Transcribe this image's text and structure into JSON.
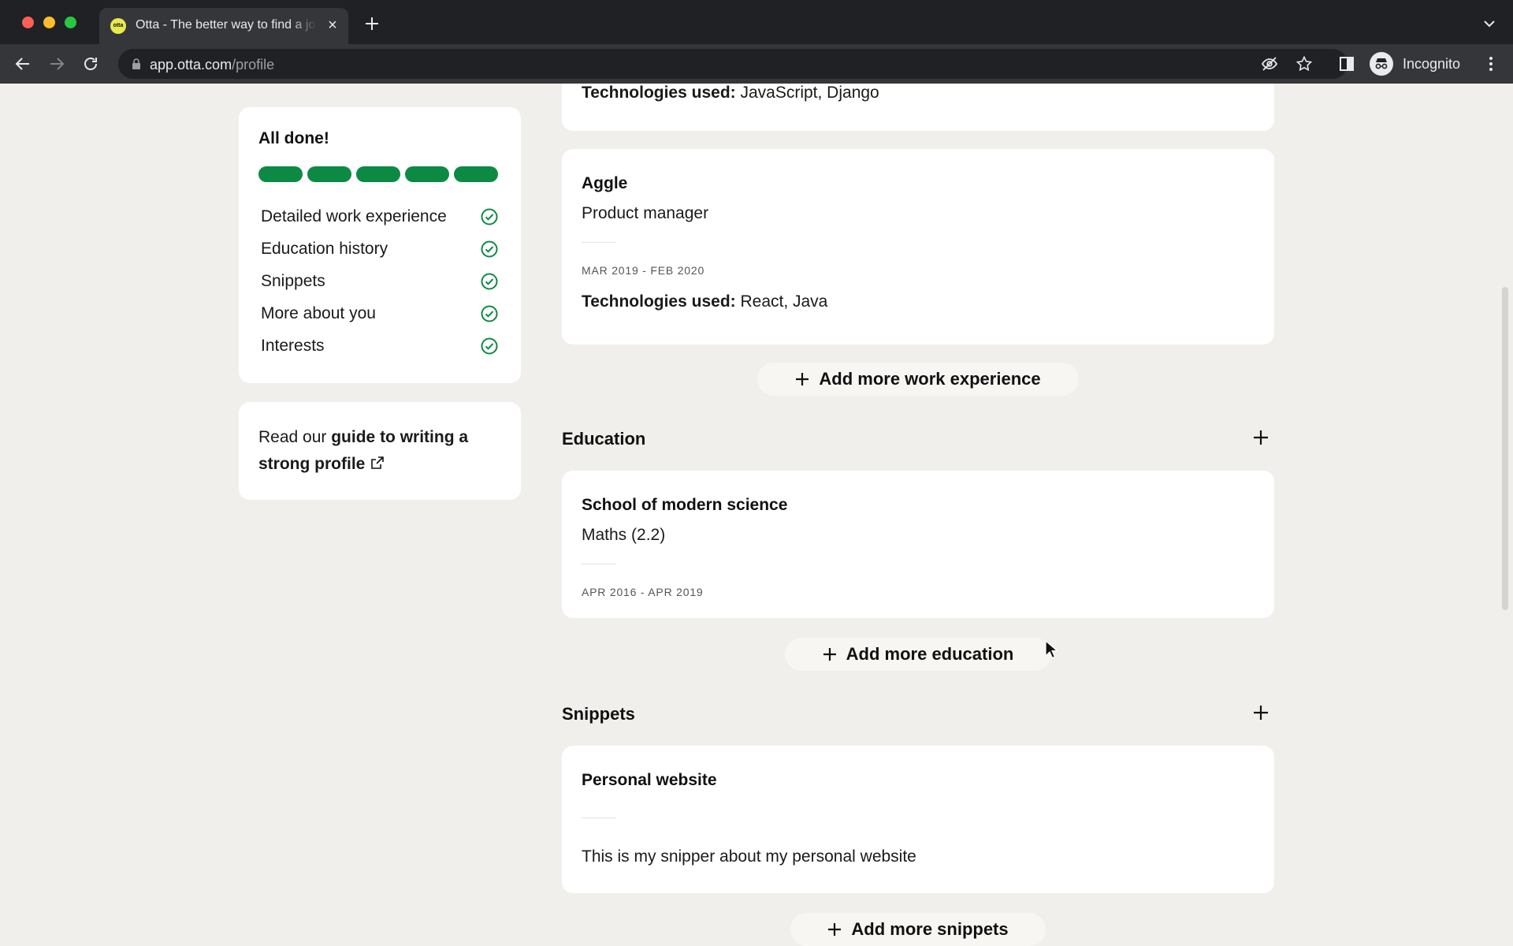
{
  "browser": {
    "tab_title": "Otta - The better way to find a job",
    "favicon_text": "otta",
    "url_host": "app.otta.com",
    "url_path": "/profile",
    "profile_label": "Incognito"
  },
  "sidebar": {
    "title": "All done!",
    "progress": {
      "completed": 5,
      "total": 5,
      "color": "#0c8a44"
    },
    "items": [
      {
        "label": "Detailed work experience",
        "done": true
      },
      {
        "label": "Education history",
        "done": true
      },
      {
        "label": "Snippets",
        "done": true
      },
      {
        "label": "More about you",
        "done": true
      },
      {
        "label": "Interests",
        "done": true
      }
    ]
  },
  "guide": {
    "prefix": "Read our ",
    "link_text": "guide to writing a strong profile"
  },
  "work": {
    "partial_tech_label": "Technologies used:",
    "partial_tech_value": " JavaScript, Django",
    "entries": [
      {
        "company": "Aggle",
        "role": "Product manager",
        "dates": "MAR 2019 - FEB 2020",
        "tech_label": "Technologies used:",
        "tech_value": " React, Java"
      }
    ],
    "add_label": "Add more work experience"
  },
  "education": {
    "title": "Education",
    "entries": [
      {
        "school": "School of modern science",
        "course": "Maths (2.2)",
        "dates": "APR 2016 - APR 2019"
      }
    ],
    "add_label": "Add more education"
  },
  "snippets": {
    "title": "Snippets",
    "entries": [
      {
        "name": "Personal website",
        "text": "This is my snipper about my personal website"
      }
    ],
    "add_label": "Add more snippets"
  },
  "colors": {
    "accent_green": "#0c8a44",
    "page_bg": "#f0efeb"
  }
}
